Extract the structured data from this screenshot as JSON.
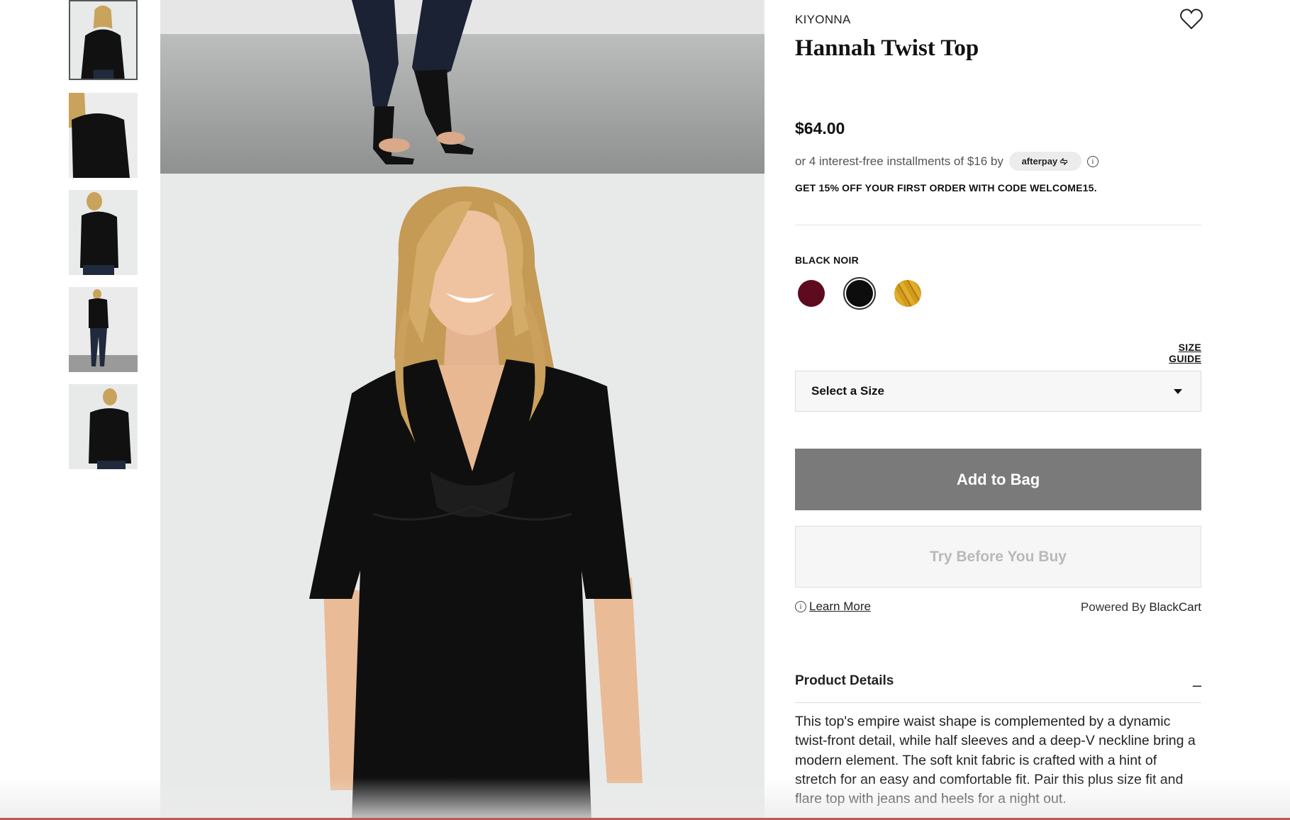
{
  "product": {
    "brand": "KIYONNA",
    "title": "Hannah Twist Top",
    "price": "$64.00",
    "installments_text": "or 4 interest-free installments of $16 by",
    "afterpay_label": "afterpay",
    "promo": "GET 15% OFF YOUR FIRST ORDER WITH CODE WELCOME15.",
    "color_label": "BLACK NOIR",
    "swatches": [
      {
        "name": "burgundy",
        "color": "#5e0a1f"
      },
      {
        "name": "black-noir",
        "color": "#0d0d0d",
        "selected": true
      },
      {
        "name": "gold",
        "color": "#d29a1c"
      }
    ],
    "size_guide": "SIZE GUIDE",
    "size_placeholder": "Select a Size",
    "add_to_bag": "Add to Bag",
    "try_before": "Try Before You Buy",
    "learn_more": "Learn More",
    "powered_prefix": "Powered By ",
    "powered_brand": "BlackCart",
    "details_heading": "Product Details",
    "details_toggle": "–",
    "description": "This top's empire waist shape is complemented by a dynamic twist-front detail, while half sleeves and a deep-V neckline bring a modern element. The soft knit fabric is crafted with a hint of stretch for an easy and comfortable fit. Pair this plus size fit and flare top with jeans and heels for a night out."
  },
  "icons": {
    "wishlist": "heart-outline-icon",
    "info": "info-circle-icon",
    "dropdown": "caret-down-icon"
  },
  "gallery": {
    "thumbnail_count": 5,
    "active_thumbnail": 1
  }
}
